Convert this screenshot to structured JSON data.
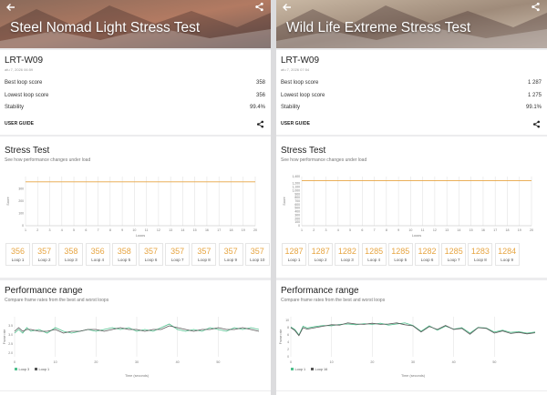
{
  "colors": {
    "accent": "#e7a542",
    "loop_best": "#4fbf8c",
    "loop_worst": "#555555"
  },
  "panes": [
    {
      "hero_title": "Steel Nomad Light Stress Test",
      "device_name": "LRT-W09",
      "date": "afu 7, 2026 06:59",
      "stats": [
        {
          "label": "Best loop score",
          "value": "358"
        },
        {
          "label": "Lowest loop score",
          "value": "356"
        },
        {
          "label": "Stability",
          "value": "99.4%"
        }
      ],
      "user_guide": "USER GUIDE",
      "stress_title": "Stress Test",
      "stress_subtitle": "See how performance changes under load",
      "loops": [
        {
          "score": "356",
          "label": "Loop 1"
        },
        {
          "score": "357",
          "label": "Loop 2"
        },
        {
          "score": "358",
          "label": "Loop 3"
        },
        {
          "score": "356",
          "label": "Loop 4"
        },
        {
          "score": "358",
          "label": "Loop 5"
        },
        {
          "score": "357",
          "label": "Loop 6"
        },
        {
          "score": "357",
          "label": "Loop 7"
        },
        {
          "score": "357",
          "label": "Loop 8"
        },
        {
          "score": "357",
          "label": "Loop 9"
        },
        {
          "score": "357",
          "label": "Loop 10"
        }
      ],
      "perf_title": "Performance range",
      "perf_subtitle": "Compare frame rates from the best and worst loops",
      "legend": [
        "Loop 3",
        "Loop 1"
      ],
      "perf_ylabel": "Frame rate",
      "perf_xlabel": "Time (seconds)"
    },
    {
      "hero_title": "Wild Life Extreme Stress Test",
      "device_name": "LRT-W09",
      "date": "afu 7, 2026 07:54",
      "stats": [
        {
          "label": "Best loop score",
          "value": "1 287"
        },
        {
          "label": "Lowest loop score",
          "value": "1 275"
        },
        {
          "label": "Stability",
          "value": "99.1%"
        }
      ],
      "user_guide": "USER GUIDE",
      "stress_title": "Stress Test",
      "stress_subtitle": "See how performance changes under load",
      "loops": [
        {
          "score": "1287",
          "label": "Loop 1"
        },
        {
          "score": "1287",
          "label": "Loop 2"
        },
        {
          "score": "1282",
          "label": "Loop 3"
        },
        {
          "score": "1285",
          "label": "Loop 4"
        },
        {
          "score": "1285",
          "label": "Loop 5"
        },
        {
          "score": "1282",
          "label": "Loop 6"
        },
        {
          "score": "1285",
          "label": "Loop 7"
        },
        {
          "score": "1283",
          "label": "Loop 8"
        },
        {
          "score": "1284",
          "label": "Loop 9"
        }
      ],
      "perf_title": "Performance range",
      "perf_subtitle": "Compare frame rates from the best and worst loops",
      "legend": [
        "Loop 1",
        "Loop 16"
      ],
      "perf_ylabel": "Frame rate",
      "perf_xlabel": "Time (seconds)"
    }
  ],
  "chart_data": [
    {
      "type": "line",
      "title": "Stress Test",
      "ylabel": "Score",
      "xlabel": "Loops",
      "x": [
        1,
        2,
        3,
        4,
        5,
        6,
        7,
        8,
        9,
        10,
        11,
        12,
        13,
        14,
        15,
        16,
        17,
        18,
        19,
        20
      ],
      "y_ticks": [
        "0",
        "100",
        "200",
        "300"
      ],
      "ylim": [
        0,
        400
      ],
      "series": [
        {
          "values": [
            357,
            357,
            357,
            357,
            357,
            357,
            357,
            357,
            357,
            357,
            357,
            357,
            357,
            357,
            357,
            357,
            357,
            357,
            357,
            357
          ]
        }
      ]
    },
    {
      "type": "line",
      "title": "Performance range",
      "ylabel": "Frame rate",
      "xlabel": "Time (seconds)",
      "x_ticks": [
        "0",
        "10",
        "20",
        "30",
        "40",
        "50"
      ],
      "y_ticks": [
        "2.0",
        "2.5",
        "3.0",
        "3.5"
      ],
      "xlim": [
        0,
        60
      ],
      "ylim": [
        1.8,
        4.0
      ],
      "series": [
        {
          "name": "Loop 3",
          "x": [
            0,
            1,
            2,
            3,
            4,
            6,
            8,
            10,
            12,
            14,
            16,
            18,
            20,
            22,
            24,
            26,
            28,
            30,
            32,
            34,
            36,
            38,
            40,
            42,
            44,
            46,
            48,
            50,
            52,
            54,
            56,
            58,
            60
          ],
          "values": [
            3.1,
            3.3,
            3.1,
            3.4,
            3.2,
            3.3,
            3.1,
            3.4,
            3.2,
            3.1,
            3.2,
            3.3,
            3.2,
            3.3,
            3.4,
            3.3,
            3.4,
            3.2,
            3.3,
            3.2,
            3.4,
            3.6,
            3.3,
            3.2,
            3.3,
            3.2,
            3.4,
            3.3,
            3.2,
            3.4,
            3.3,
            3.4,
            3.3
          ]
        },
        {
          "name": "Loop 1",
          "x": [
            0,
            1,
            2,
            3,
            4,
            6,
            8,
            10,
            12,
            14,
            16,
            18,
            20,
            22,
            24,
            26,
            28,
            30,
            32,
            34,
            36,
            38,
            40,
            42,
            44,
            46,
            48,
            50,
            52,
            54,
            56,
            58,
            60
          ],
          "values": [
            3.2,
            3.4,
            3.2,
            3.3,
            3.3,
            3.2,
            3.2,
            3.3,
            3.1,
            3.2,
            3.2,
            3.3,
            3.3,
            3.2,
            3.3,
            3.4,
            3.3,
            3.3,
            3.2,
            3.3,
            3.3,
            3.5,
            3.4,
            3.3,
            3.2,
            3.3,
            3.3,
            3.4,
            3.3,
            3.3,
            3.4,
            3.3,
            3.2
          ]
        }
      ]
    },
    {
      "type": "line",
      "title": "Stress Test",
      "ylabel": "Score",
      "xlabel": "Loops",
      "x": [
        1,
        2,
        3,
        4,
        5,
        6,
        7,
        8,
        9,
        10,
        11,
        12,
        13,
        14,
        15,
        16,
        17,
        18,
        19,
        20
      ],
      "y_ticks": [
        "0",
        "100",
        "200",
        "300",
        "400",
        "500",
        "600",
        "700",
        "800",
        "900",
        "1,000",
        "1,100",
        "1,200",
        "1,400"
      ],
      "ylim": [
        0,
        1400
      ],
      "series": [
        {
          "values": [
            1285,
            1285,
            1285,
            1285,
            1285,
            1285,
            1285,
            1285,
            1285,
            1285,
            1285,
            1285,
            1285,
            1285,
            1285,
            1285,
            1285,
            1285,
            1285,
            1285
          ]
        }
      ]
    },
    {
      "type": "line",
      "title": "Performance range",
      "ylabel": "Frame rate",
      "xlabel": "Time (seconds)",
      "x_ticks": [
        "0",
        "10",
        "20",
        "30",
        "40",
        "50"
      ],
      "y_ticks": [
        "0",
        "2",
        "4",
        "6",
        "8",
        "10"
      ],
      "xlim": [
        0,
        60
      ],
      "ylim": [
        0,
        11
      ],
      "series": [
        {
          "name": "Loop 1",
          "x": [
            0,
            1,
            2,
            3,
            4,
            6,
            8,
            10,
            12,
            14,
            16,
            18,
            20,
            22,
            24,
            26,
            28,
            30,
            32,
            34,
            36,
            38,
            40,
            42,
            44,
            46,
            48,
            50,
            52,
            54,
            56,
            58,
            60
          ],
          "values": [
            8.2,
            7.5,
            6.0,
            8.4,
            7.9,
            8.3,
            8.6,
            8.5,
            8.9,
            9.0,
            8.8,
            9.1,
            8.9,
            9.2,
            8.7,
            9.0,
            9.3,
            8.6,
            7.0,
            8.5,
            7.3,
            8.4,
            7.6,
            8.0,
            6.5,
            8.1,
            7.9,
            6.8,
            7.3,
            6.7,
            6.9,
            6.5,
            6.8
          ]
        },
        {
          "name": "Loop 16",
          "x": [
            0,
            1,
            2,
            3,
            4,
            6,
            8,
            10,
            12,
            14,
            16,
            18,
            20,
            22,
            24,
            26,
            28,
            30,
            32,
            34,
            36,
            38,
            40,
            42,
            44,
            46,
            48,
            50,
            52,
            54,
            56,
            58,
            60
          ],
          "values": [
            8.0,
            7.2,
            5.8,
            8.0,
            7.6,
            8.0,
            8.4,
            8.8,
            8.7,
            9.3,
            9.0,
            8.9,
            9.2,
            8.9,
            9.0,
            9.3,
            8.8,
            8.5,
            6.8,
            8.3,
            7.5,
            8.6,
            7.5,
            7.8,
            6.2,
            8.0,
            7.8,
            6.5,
            7.1,
            6.4,
            6.7,
            6.3,
            6.6
          ]
        }
      ]
    }
  ]
}
